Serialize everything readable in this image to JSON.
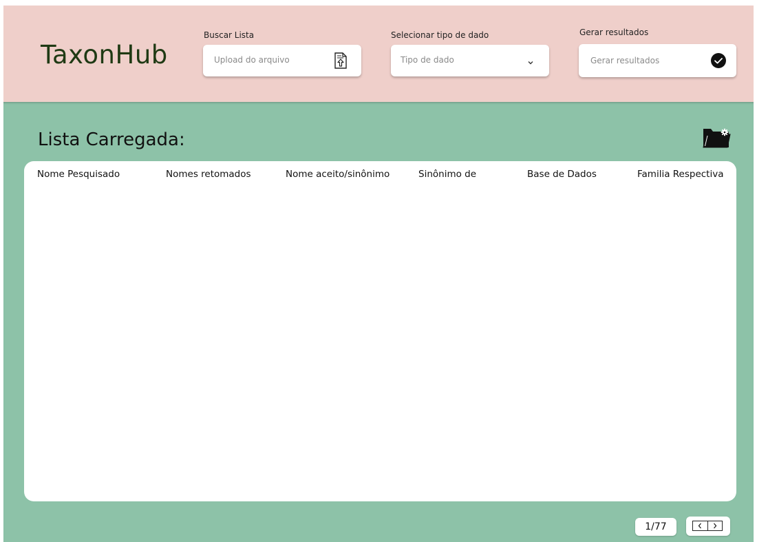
{
  "app": {
    "title": "TaxonHub"
  },
  "header": {
    "search_list": {
      "label": "Buscar Lista",
      "placeholder": "Upload do arquivo",
      "icon": "file-upload-icon"
    },
    "data_type": {
      "label": "Selecionar tipo de dado",
      "placeholder": "Tipo de dado",
      "icon": "chevron-down-icon"
    },
    "generate": {
      "label": "Gerar resultados",
      "placeholder": "Gerar resultados",
      "icon": "check-circle-icon"
    }
  },
  "main": {
    "title": "Lista Carregada:",
    "folder_icon": "folder-settings-icon",
    "table": {
      "columns": [
        "Nome  Pesquisado",
        "Nomes retomados",
        "Nome aceito/sinônimo",
        "Sinônimo de",
        "Base de Dados",
        "Familia Respectiva"
      ],
      "rows": []
    },
    "pagination": {
      "indicator": "1/77",
      "prev_icon": "chevron-left-icon",
      "next_icon": "chevron-right-icon"
    }
  },
  "colors": {
    "header_bg": "#efcfca",
    "main_bg": "#8dc2a8",
    "logo": "#1f3a14"
  }
}
